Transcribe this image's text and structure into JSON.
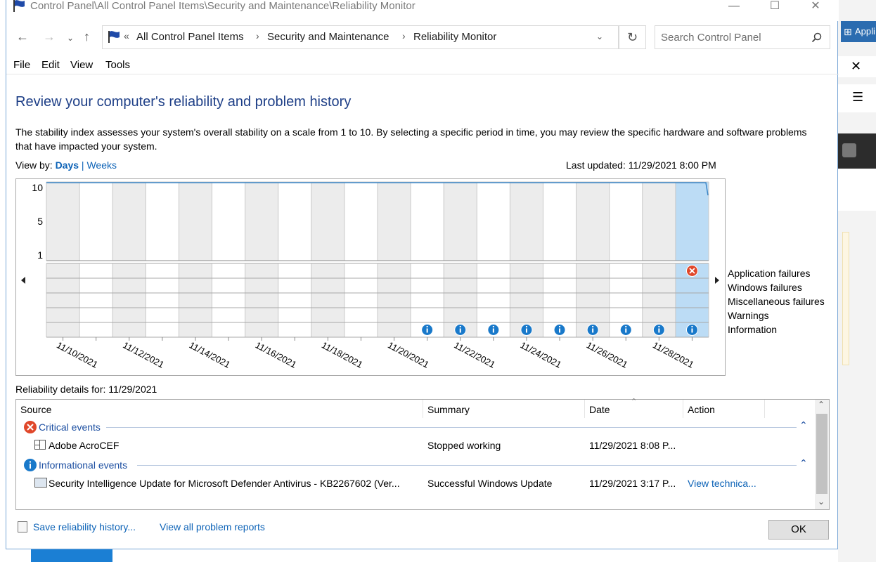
{
  "window": {
    "title": "Control Panel\\All Control Panel Items\\Security and Maintenance\\Reliability Monitor"
  },
  "address": {
    "prefix": "«",
    "crumbs": [
      "All Control Panel Items",
      "Security and Maintenance",
      "Reliability Monitor"
    ],
    "search_placeholder": "Search Control Panel"
  },
  "menu": [
    "File",
    "Edit",
    "View",
    "Tools"
  ],
  "heading": "Review your computer's reliability and problem history",
  "description": "The stability index assesses your system's overall stability on a scale from 1 to 10. By selecting a specific period in time, you may review the specific hardware and software problems that have impacted your system.",
  "view_by": {
    "label": "View by:",
    "days": "Days",
    "sep": "|",
    "weeks": "Weeks"
  },
  "last_updated": "Last updated: 11/29/2021 8:00 PM",
  "chart": {
    "y_ticks": [
      "10",
      "5",
      "1"
    ],
    "dates": [
      "11/10/2021",
      "11/12/2021",
      "11/14/2021",
      "11/16/2021",
      "11/18/2021",
      "11/20/2021",
      "11/22/2021",
      "11/24/2021",
      "11/26/2021",
      "11/28/2021"
    ],
    "legend": [
      "Application failures",
      "Windows failures",
      "Miscellaneous failures",
      "Warnings",
      "Information"
    ],
    "days": 20,
    "stability_index_start_day": 1,
    "info_event_days": [
      12,
      13,
      14,
      15,
      16,
      17,
      18,
      19,
      20
    ],
    "app_failure_days": [
      20
    ],
    "selected_day": 20,
    "colors": {
      "selected": "#bcdcf5",
      "alt_column": "#ececec",
      "line": "#3d87c7",
      "info": "#1979ca",
      "error": "#e0472a"
    }
  },
  "details": {
    "label": "Reliability details for: 11/29/2021",
    "columns": [
      "Source",
      "Summary",
      "Date",
      "Action"
    ],
    "groups": [
      {
        "title": "Critical events",
        "icon": "error-icon",
        "rows": [
          {
            "source": "Adobe AcroCEF",
            "summary": "Stopped working",
            "date": "11/29/2021 8:08 P...",
            "action": ""
          }
        ]
      },
      {
        "title": "Informational events",
        "icon": "info-icon",
        "rows": [
          {
            "source": "Security Intelligence Update for Microsoft Defender Antivirus - KB2267602 (Ver...",
            "summary": "Successful Windows Update",
            "date": "11/29/2021 3:17 P...",
            "action": "View technica..."
          }
        ]
      }
    ]
  },
  "footer": {
    "save_link": "Save reliability history...",
    "view_all_link": "View all problem reports",
    "ok": "OK"
  }
}
